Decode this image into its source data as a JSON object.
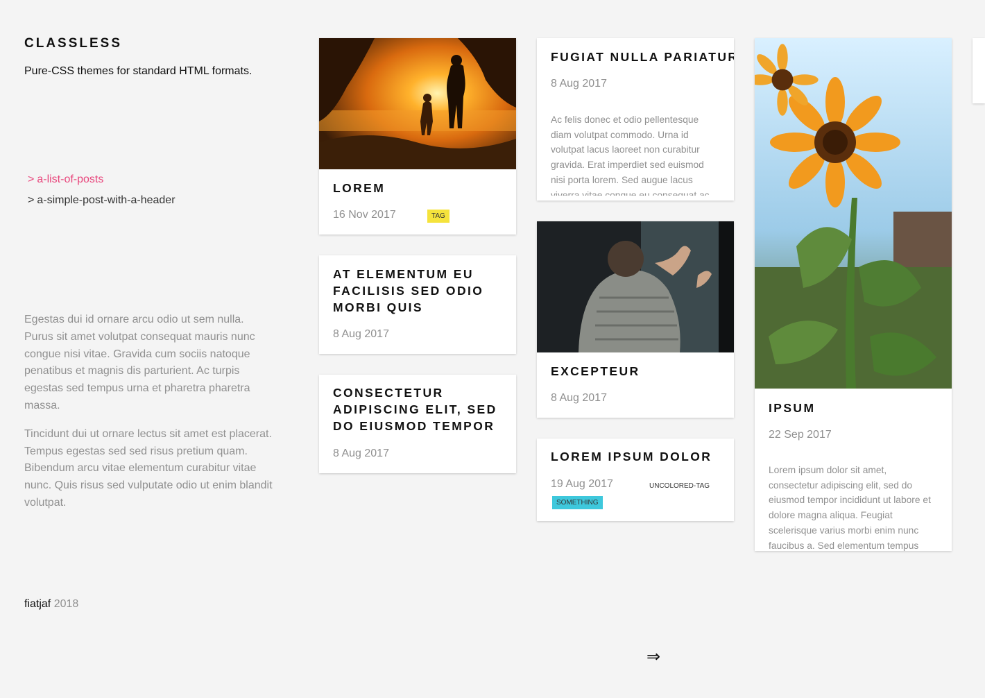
{
  "site": {
    "title": "CLASSLESS",
    "description": "Pure-CSS themes for standard HTML formats."
  },
  "nav": {
    "arrow": ">",
    "items": [
      {
        "label": "a-list-of-posts",
        "active": true
      },
      {
        "label": "a-simple-post-with-a-header",
        "active": false
      }
    ]
  },
  "about": {
    "paragraphs": [
      "Egestas dui id ornare arcu odio ut sem nulla. Purus sit amet volutpat consequat mauris nunc congue nisi vitae. Gravida cum sociis natoque penatibus et magnis dis parturient. Ac turpis egestas sed tempus urna et pharetra pharetra massa.",
      "Tincidunt dui ut ornare lectus sit amet est placerat. Tempus egestas sed sed risus pretium quam. Bibendum arcu vitae elementum curabitur vitae nunc. Quis risus sed vulputate odio ut enim blandit volutpat."
    ]
  },
  "footer": {
    "author": "fiatjaf",
    "year": "2018"
  },
  "posts": [
    {
      "title": "Lorem",
      "date": "16 Nov 2017",
      "tags": [
        "tag"
      ],
      "image": "sunset-family-photo"
    },
    {
      "title": "At elementum eu facilisis sed odio morbi quis",
      "date": "8 Aug 2017"
    },
    {
      "title": "Consectetur adipiscing elit, sed do eiusmod tempor",
      "date": "8 Aug 2017"
    },
    {
      "title": "Fugiat nulla pariatur",
      "date": "8 Aug 2017",
      "excerpt": "Ac felis donec et odio pellentesque diam volutpat commodo. Urna id volutpat lacus laoreet non curabitur gravida. Erat imperdiet sed euismod nisi porta lorem. Sed augue lacus viverra vitae congue eu consequat ac."
    },
    {
      "title": "Excepteur",
      "date": "8 Aug 2017",
      "image": "embracing-people-photo"
    },
    {
      "title": "Lorem ipsum dolor",
      "date": "19 Aug 2017",
      "tags": [
        "uncolored-tag",
        "something"
      ]
    },
    {
      "title": "Ipsum",
      "date": "22 Sep 2017",
      "image": "sunflowers-photo",
      "excerpt": "Lorem ipsum dolor sit amet, consectetur adipiscing elit, sed do eiusmod tempor incididunt ut labore et dolore magna aliqua. Feugiat scelerisque varius morbi enim nunc faucibus a. Sed elementum tempus"
    }
  ],
  "pagination": {
    "next_label": "⇒"
  },
  "colors": {
    "accent": "#e8467c",
    "tag_yellow": "#f5e33c",
    "tag_cyan": "#3ec8dc",
    "background": "#f4f4f4",
    "muted_text": "#909090"
  }
}
